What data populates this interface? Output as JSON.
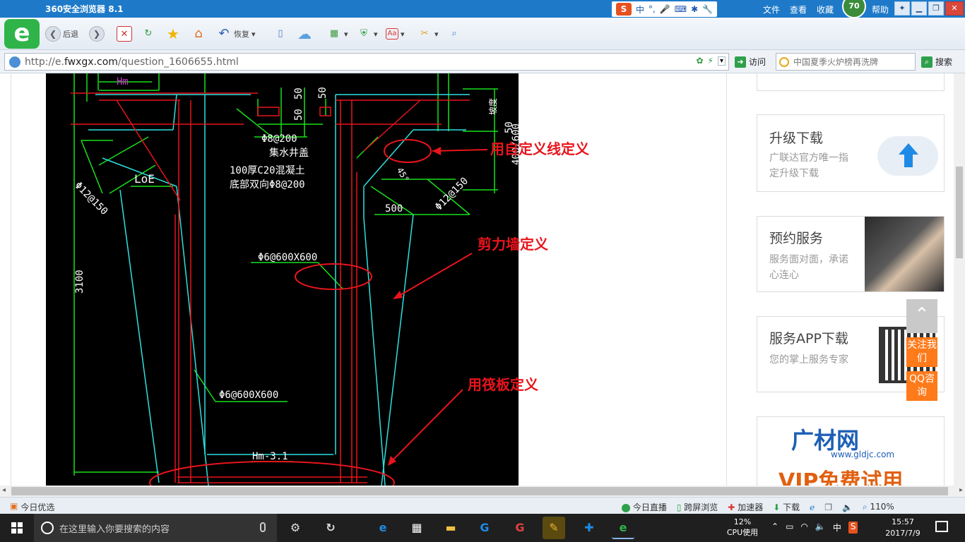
{
  "browser": {
    "title": "360安全浏览器 8.1",
    "menu": [
      "文件",
      "查看",
      "收藏",
      "帮助"
    ],
    "level_badge": "70",
    "ime_items": [
      "中",
      "°,"
    ],
    "back_label": "后退",
    "restore_label": "恢复",
    "url_prefix": "http://e.",
    "url_host": "fwxgx.com",
    "url_path": "/question_1606655.html",
    "visit_label": "访问",
    "search_placeholder": "中国夏季火炉榜再洗牌",
    "search_label": "搜索"
  },
  "drawing": {
    "labels": {
      "hm": "Hm",
      "d50a": "50",
      "d50b": "50",
      "d50c": "50",
      "d50d": "50",
      "slope": "坡度",
      "phi8_200": "Φ8@200",
      "pit_title": "集水井盖",
      "pit_concrete": "100厚C20混凝土",
      "pit_bottom": "底部双向Φ8@200",
      "phi12_left": "Φ12@150",
      "loe": "LoE",
      "dim_400_600": "400/600",
      "phi12_right": "Φ12@150",
      "dim_500": "500",
      "phi6_a": "Φ6@600X600",
      "dim_3100": "3100",
      "phi6_b": "Φ6@600X600",
      "hm_31": "Hm-3.1",
      "angle": "45°"
    },
    "annotations": {
      "custom_line": "用自定义线定义",
      "shear_wall": "剪力墙定义",
      "raft": "用筏板定义"
    },
    "annotation_color": "#e8141c"
  },
  "sidebar": {
    "card_upgrade": {
      "title": "升级下载",
      "desc": "广联达官方唯一指定升级下载"
    },
    "card_booking": {
      "title": "预约服务",
      "desc": "服务面对面，承诺心连心"
    },
    "card_app": {
      "title": "服务APP下载",
      "desc": "您的掌上服务专家"
    },
    "ad_brand": "广材网",
    "ad_url": "www.gldjc.com",
    "ad_vip": "VIP免费试用",
    "follow_label": "关注我们",
    "qq_label": "QQ咨询"
  },
  "statusbar": {
    "today_pick": "今日优选",
    "live": "今日直播",
    "cross_screen": "跨屏浏览",
    "accelerator": "加速器",
    "download": "下载",
    "zoom": "110%"
  },
  "taskbar": {
    "search_placeholder": "在这里输入你要搜索的内容",
    "cpu_percent": "12%",
    "cpu_label": "CPU使用",
    "ime": "中",
    "time": "15:57",
    "date": "2017/7/9"
  }
}
